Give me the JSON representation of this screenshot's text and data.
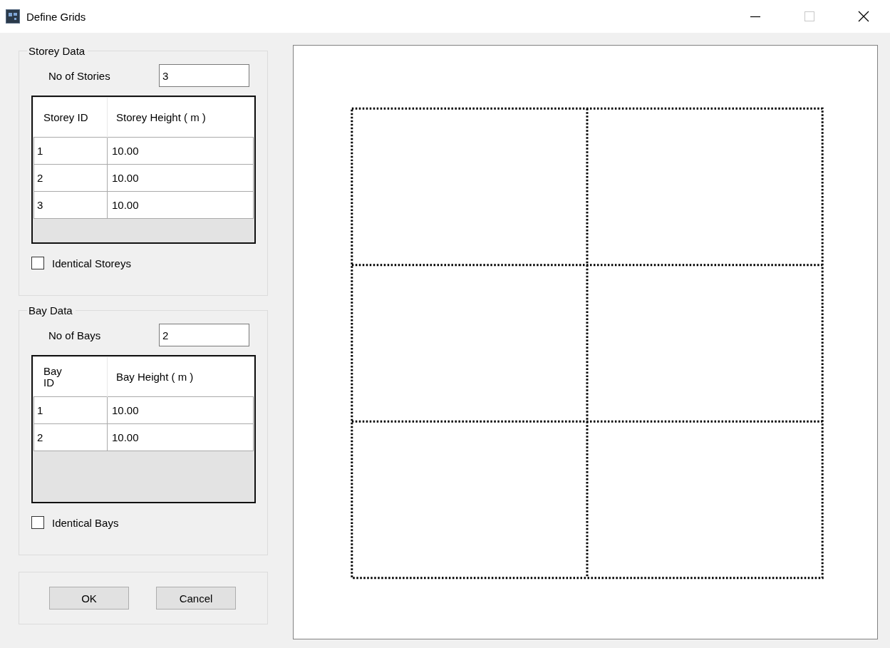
{
  "window": {
    "title": "Define Grids"
  },
  "storey_data": {
    "title": "Storey Data",
    "count_label": "No of Stories",
    "count_value": "3",
    "columns": [
      "Storey ID",
      "Storey Height ( m )"
    ],
    "rows": [
      [
        "1",
        "10.00"
      ],
      [
        "2",
        "10.00"
      ],
      [
        "3",
        "10.00"
      ]
    ],
    "identical": {
      "label": "Identical Storeys",
      "checked": false
    }
  },
  "bay_data": {
    "title": "Bay Data",
    "count_label": "No of Bays",
    "count_value": "2",
    "columns": [
      "Bay\nID",
      "Bay Height ( m )"
    ],
    "rows": [
      [
        "1",
        "10.00"
      ],
      [
        "2",
        "10.00"
      ]
    ],
    "identical": {
      "label": "Identical Bays",
      "checked": false
    }
  },
  "buttons": [
    "OK",
    "Cancel"
  ]
}
